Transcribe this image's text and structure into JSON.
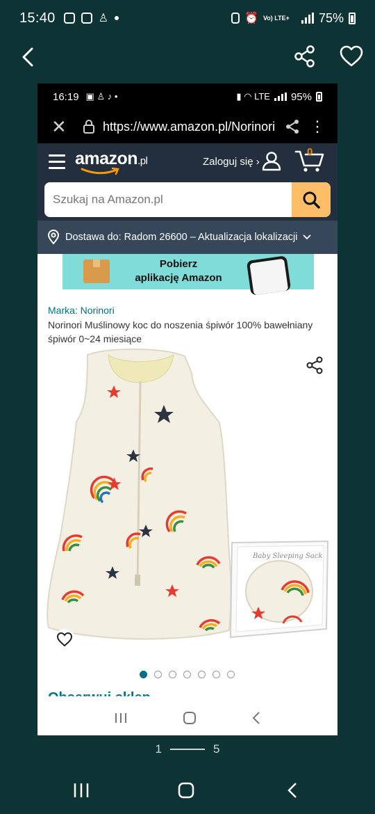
{
  "outer_status": {
    "time": "15:40",
    "battery": "75%",
    "net": "Vo) LTE+"
  },
  "gallery": {
    "page_current": "1",
    "page_total": "5"
  },
  "inner_status": {
    "time": "16:19",
    "battery": "95%"
  },
  "browser": {
    "url": "https://www.amazon.pl/Norinori"
  },
  "amazon": {
    "logo": "amazon",
    "logo_tld": ".pl",
    "signin": "Zaloguj się ›",
    "cart_count": "0",
    "search_placeholder": "Szukaj na Amazon.pl",
    "delivery": "Dostawa do: Radom 26600 – Aktualizacja lokalizacji"
  },
  "banner": {
    "line1": "Pobierz",
    "line2": "aplikację Amazon"
  },
  "product": {
    "brand": "Marka: Norinori",
    "title": "Norinori Muślinowy koc do noszenia śpiwór 100% bawełniany śpiwór 0~24 miesiące",
    "box_label": "Baby Sleeping Sack",
    "image_count": 7,
    "active_image": 0,
    "next_section": "Obserwuj sklep"
  },
  "colors": {
    "amazon_dark": "#232f3e",
    "amazon_nav": "#37475a",
    "search_btn": "#febd69",
    "link": "#007185",
    "bg": "#0e3335"
  }
}
